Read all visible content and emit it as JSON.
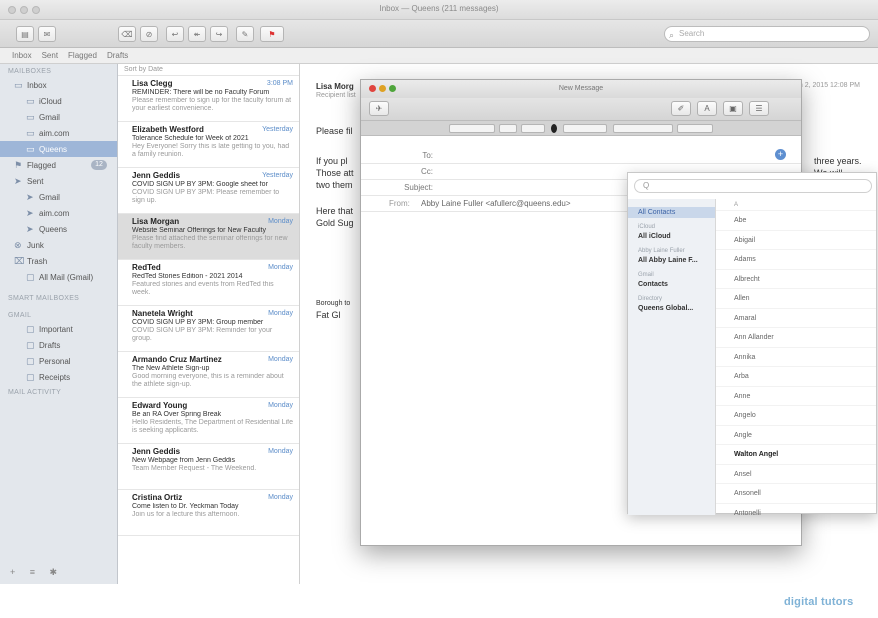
{
  "window": {
    "title": "Inbox — Queens (211 messages)"
  },
  "toolbar": {
    "search_placeholder": "Search"
  },
  "favorites": [
    "Inbox",
    "Sent",
    "Flagged",
    "Drafts"
  ],
  "sidebar": {
    "mailboxes_head": "MAILBOXES",
    "items": [
      {
        "label": "Inbox",
        "level": 1,
        "icon": "inbox-icon"
      },
      {
        "label": "iCloud",
        "level": 2,
        "icon": "inbox-icon"
      },
      {
        "label": "Gmail",
        "level": 2,
        "icon": "inbox-icon"
      },
      {
        "label": "aim.com",
        "level": 2,
        "icon": "inbox-icon"
      },
      {
        "label": "Queens",
        "level": 2,
        "icon": "inbox-icon",
        "selected": true
      },
      {
        "label": "Flagged",
        "level": 1,
        "icon": "flag-icon",
        "badge": "12"
      },
      {
        "label": "Sent",
        "level": 1,
        "icon": "sent-icon"
      },
      {
        "label": "Gmail",
        "level": 2,
        "icon": "sent-icon"
      },
      {
        "label": "aim.com",
        "level": 2,
        "icon": "sent-icon"
      },
      {
        "label": "Queens",
        "level": 2,
        "icon": "sent-icon"
      },
      {
        "label": "Junk",
        "level": 1,
        "icon": "junk-icon"
      },
      {
        "label": "Trash",
        "level": 1,
        "icon": "trash-icon"
      },
      {
        "label": "All Mail (Gmail)",
        "level": 2,
        "icon": "folder-icon"
      }
    ],
    "smart_head": "SMART MAILBOXES",
    "gmail_head": "GMAIL",
    "gmail_items": [
      {
        "label": "Important",
        "icon": "folder-icon"
      },
      {
        "label": "Drafts",
        "icon": "folder-icon"
      },
      {
        "label": "Personal",
        "icon": "folder-icon"
      },
      {
        "label": "Receipts",
        "icon": "folder-icon"
      }
    ],
    "activity_head": "MAIL ACTIVITY"
  },
  "messages": {
    "sort_label": "Sort by Date",
    "items": [
      {
        "from": "Lisa Clegg",
        "date": "3:08 PM",
        "subject": "REMINDER: There will be no Faculty Forum",
        "preview": "Please remember to sign up for the faculty forum at your earliest convenience."
      },
      {
        "from": "Elizabeth Westford",
        "date": "Yesterday",
        "subject": "Tolerance Schedule for Week of 2021",
        "preview": "Hey Everyone! Sorry this is late getting to you, had a family reunion."
      },
      {
        "from": "Jenn Geddis",
        "date": "Yesterday",
        "subject": "COVID SIGN UP BY 3PM: Google sheet for",
        "preview": "COVID SIGN UP BY 3PM: Please remember to sign up."
      },
      {
        "from": "Lisa Morgan",
        "date": "Monday",
        "subject": "Website Seminar Offerings for New Faculty",
        "preview": "Please find attached the seminar offerings for new faculty members.",
        "selected": true
      },
      {
        "from": "RedTed",
        "date": "Monday",
        "subject": "RedTed Stories Edition - 2021 2014",
        "preview": "Featured stories and events from RedTed this week."
      },
      {
        "from": "Nanetela Wright",
        "date": "Monday",
        "subject": "COVID SIGN UP BY 3PM: Group member",
        "preview": "COVID SIGN UP BY 3PM: Reminder for your group."
      },
      {
        "from": "Armando Cruz Martinez",
        "date": "Monday",
        "subject": "The New Athlete Sign-up",
        "preview": "Good morning everyone, this is a reminder about the athlete sign-up."
      },
      {
        "from": "Edward Young",
        "date": "Monday",
        "subject": "Be an RA Over Spring Break",
        "preview": "Hello Residents, The Department of Residential Life is seeking applicants."
      },
      {
        "from": "Jenn Geddis",
        "date": "Monday",
        "subject": "New Webpage from Jenn Geddis",
        "preview": "Team Member Request - The Weekend."
      },
      {
        "from": "Cristina Ortiz",
        "date": "Monday",
        "subject": "Come listen to Dr. Yeckman Today",
        "preview": "Join us for a lecture this afternoon."
      }
    ]
  },
  "reading": {
    "from": "Lisa Morg",
    "to": "Recipient list",
    "date": "March 2, 2015 12:08 PM",
    "lines": [
      "Please fil",
      "If you pl",
      "Those att",
      "two them",
      "Here that",
      "Gold Sug"
    ],
    "right_lines": [
      "three years.",
      "We will"
    ],
    "signoff": [
      "Borough to",
      "Fat Gl"
    ]
  },
  "compose": {
    "title": "New Message",
    "fields": {
      "to_label": "To:",
      "cc_label": "Cc:",
      "subject_label": "Subject:",
      "from_label": "From:",
      "from_value": "Abby Laine Fuller <afullerc@queens.edu>"
    }
  },
  "contacts": {
    "search_placeholder": "Q",
    "groups": [
      {
        "head": "",
        "name": "All Contacts",
        "selected": true
      },
      {
        "head": "iCloud",
        "name": "All iCloud"
      },
      {
        "head": "Abby Laine Fuller",
        "name": "All Abby Laine F..."
      },
      {
        "head": "Gmail",
        "name": "Contacts"
      },
      {
        "head": "Directory",
        "name": "Queens Global..."
      }
    ],
    "alpha_head": "A",
    "names": [
      "Abe",
      "Abigail",
      "Adams",
      "Albrecht",
      "Allen",
      "Amaral",
      "Ann Allander",
      "Annika",
      "Arba",
      "Anne",
      "Angelo",
      "Angle",
      "Walton Angel",
      "Ansel",
      "Ansonell",
      "Antonelli"
    ]
  },
  "watermark": "digital tutors"
}
